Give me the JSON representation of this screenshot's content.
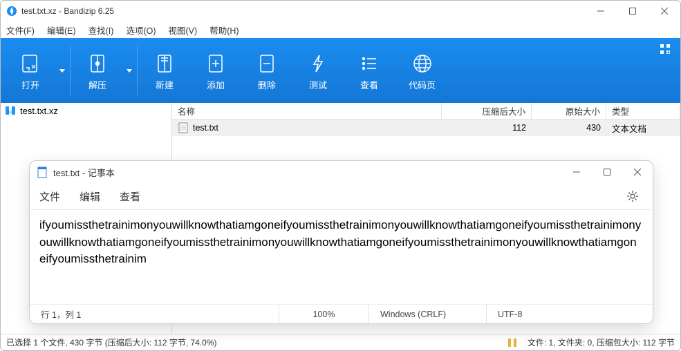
{
  "titlebar": {
    "title": "test.txt.xz - Bandizip 6.25"
  },
  "menu": {
    "file": "文件(F)",
    "edit": "编辑(E)",
    "find": "查找(I)",
    "options": "选项(O)",
    "view": "视图(V)",
    "help": "帮助(H)"
  },
  "toolbar": {
    "open": "打开",
    "extract": "解压",
    "new": "新建",
    "add": "添加",
    "delete": "删除",
    "test": "测试",
    "view": "查看",
    "codepage": "代码页"
  },
  "tree": {
    "root": "test.txt.xz"
  },
  "columns": {
    "name": "名称",
    "compressed": "压缩后大小",
    "original": "原始大小",
    "type": "类型"
  },
  "files": [
    {
      "name": "test.txt",
      "compressed": "112",
      "original": "430",
      "type": "文本文档"
    }
  ],
  "status": {
    "selection": "已选择 1 个文件, 430 字节 (压缩后大小: 112 字节, 74.0%)",
    "counts": "文件: 1, 文件夹: 0, 压缩包大小: 112 字节"
  },
  "notepad": {
    "title": "test.txt - 记事本",
    "menu": {
      "file": "文件",
      "edit": "编辑",
      "view": "查看"
    },
    "content": "ifyoumissthetrainimonyouwillknowthatiamgoneifyoumissthetrainimonyouwillknowthatiamgoneifyoumissthetrainimonyouwillknowthatiamgoneifyoumissthetrainimonyouwillknowthatiamgoneifyoumissthetrainimonyouwillknowthatiamgoneifyoumissthetrainim",
    "status": {
      "cursor": "行 1，列 1",
      "zoom": "100%",
      "eol": "Windows (CRLF)",
      "encoding": "UTF-8"
    }
  }
}
